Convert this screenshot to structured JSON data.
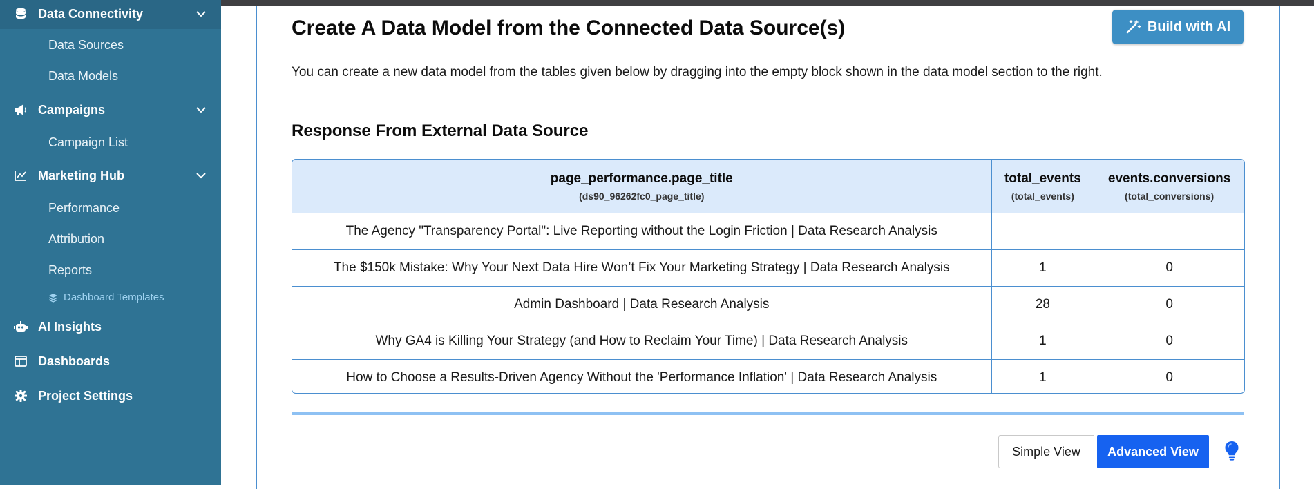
{
  "sidebar": {
    "sections": {
      "data_connectivity": "Data Connectivity",
      "campaigns": "Campaigns",
      "marketing_hub": "Marketing Hub",
      "ai_insights": "AI Insights",
      "dashboards": "Dashboards",
      "project_settings": "Project Settings"
    },
    "items": {
      "data_sources": "Data Sources",
      "data_models": "Data Models",
      "campaign_list": "Campaign List",
      "performance": "Performance",
      "attribution": "Attribution",
      "reports": "Reports",
      "dashboard_templates": "Dashboard Templates"
    }
  },
  "main": {
    "title": "Create A Data Model from the Connected Data Source(s)",
    "build_ai_label": "Build with AI",
    "intro": "You can create a new data model from the tables given below by dragging into the empty block shown in the data model section to the right.",
    "section_title": "Response From External Data Source",
    "table": {
      "columns": [
        {
          "name": "page_performance.page_title",
          "sub": "(ds90_96262fc0_page_title)"
        },
        {
          "name": "total_events",
          "sub": "(total_events)"
        },
        {
          "name": "events.conversions",
          "sub": "(total_conversions)"
        }
      ],
      "rows": [
        [
          "The Agency \"Transparency Portal\": Live Reporting without the Login Friction | Data Research Analysis",
          "",
          ""
        ],
        [
          "The $150k Mistake: Why Your Next Data Hire Won’t Fix Your Marketing Strategy | Data Research Analysis",
          "1",
          "0"
        ],
        [
          "Admin Dashboard | Data Research Analysis",
          "28",
          "0"
        ],
        [
          "Why GA4 is Killing Your Strategy (and How to Reclaim Your Time) | Data Research Analysis",
          "1",
          "0"
        ],
        [
          "How to Choose a Results-Driven Agency Without the 'Performance Inflation' | Data Research Analysis",
          "1",
          "0"
        ]
      ]
    },
    "view_toggle": {
      "simple_label": "Simple View",
      "advanced_label": "Advanced View"
    }
  },
  "icons": {
    "data_connectivity": "database-icon",
    "campaigns": "megaphone-icon",
    "marketing_hub": "line-chart-icon",
    "ai_insights": "robot-icon",
    "dashboards": "table-layout-icon",
    "project_settings": "gear-icon",
    "dashboard_templates": "layers-icon",
    "build_ai": "magic-wand-icon",
    "tip": "lightbulb-icon"
  },
  "colors": {
    "sidebar_bg": "#2f7394",
    "accent": "#3d8fc4",
    "primary_button": "#1662f0",
    "table_header_bg": "#dbeafb",
    "border": "#4b8fd0"
  }
}
